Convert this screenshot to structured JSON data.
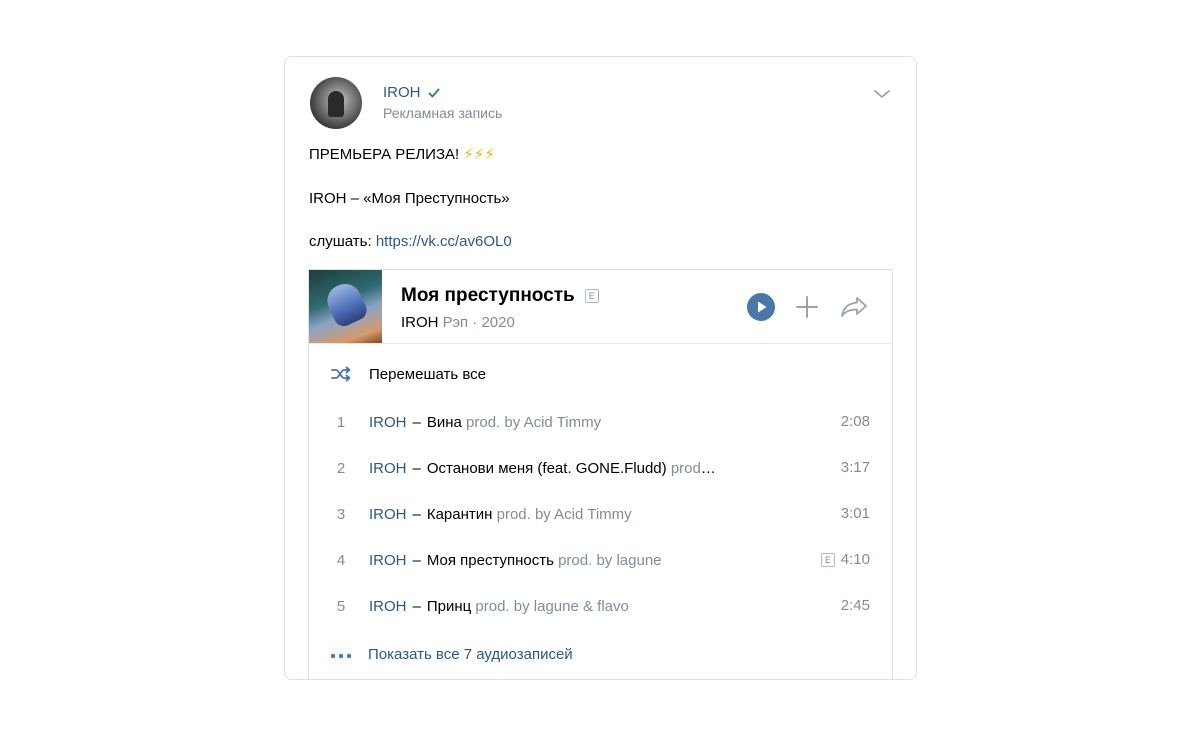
{
  "post": {
    "author": "IROH",
    "subtitle": "Рекламная запись",
    "line1": "ПРЕМЬЕРА РЕЛИЗА!",
    "bolts": "⚡⚡⚡",
    "line2": "IROH – «Моя Преступность»",
    "listen_label": "слушать:",
    "listen_link": "https://vk.cc/av6OL0"
  },
  "album": {
    "title": "Моя преступность",
    "explicit_badge": "E",
    "artist": "IROH",
    "genre": "Рэп",
    "separator": "·",
    "year": "2020"
  },
  "shuffle_label": "Перемешать все",
  "tracks": [
    {
      "num": "1",
      "artist": "IROH",
      "dash": "–",
      "name": "Вина",
      "prod": "prod. by Acid Timmy",
      "duration": "2:08",
      "explicit": false
    },
    {
      "num": "2",
      "artist": "IROH",
      "dash": "–",
      "name": "Останови меня (feat. GONE.Fludd)",
      "prod": "prod. by",
      "duration": "3:17",
      "explicit": false
    },
    {
      "num": "3",
      "artist": "IROH",
      "dash": "–",
      "name": "Карантин",
      "prod": "prod. by Acid Timmy",
      "duration": "3:01",
      "explicit": false
    },
    {
      "num": "4",
      "artist": "IROH",
      "dash": "–",
      "name": "Моя преступность",
      "prod": "prod. by lagune",
      "duration": "4:10",
      "explicit": true,
      "explicit_badge": "E"
    },
    {
      "num": "5",
      "artist": "IROH",
      "dash": "–",
      "name": "Принц",
      "prod": "prod. by lagune & flavo",
      "duration": "2:45",
      "explicit": false
    }
  ],
  "show_all": "Показать все 7 аудиозаписей",
  "colors": {
    "link": "#2a5885",
    "muted": "#818c99",
    "accent": "#4a76a8",
    "border": "#dce1e6"
  },
  "icons": [
    "verified-icon",
    "chevron-down-icon",
    "play-icon",
    "plus-icon",
    "share-icon",
    "shuffle-icon",
    "more-dots-icon"
  ]
}
